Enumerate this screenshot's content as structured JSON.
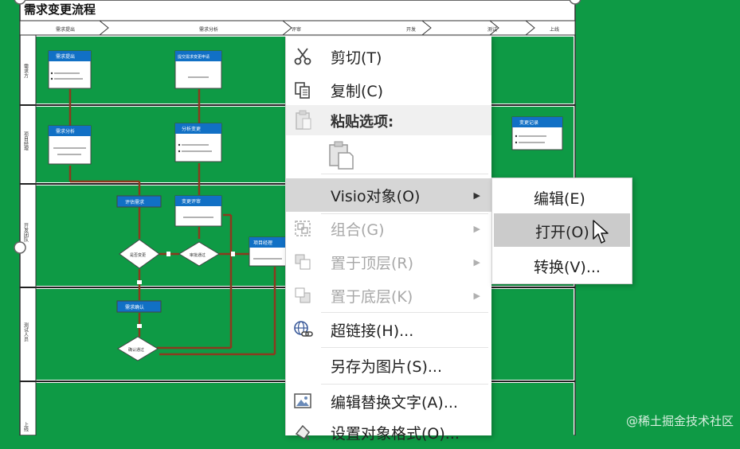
{
  "document": {
    "title": "需求变更流程",
    "lanes": [
      "需求方",
      "项目经理",
      "开发团队",
      "测试人员",
      "上线"
    ],
    "phase_columns": [
      "需求提出",
      "需求分析",
      "评审",
      "开发",
      "测试",
      "上线"
    ],
    "nodes": {
      "n1": "需求提出",
      "n2": "提交需求变更申请",
      "n3": "需求分析",
      "n4": "分析变更",
      "n5": "评估需求",
      "n6": "变更评审",
      "n7": "项目经理",
      "n8": "需求确认",
      "n9": "变更记录",
      "n10": "评估需求"
    },
    "diamonds": {
      "d1": "是否变更",
      "d2": "审批通过",
      "d3": "确认通过"
    }
  },
  "context_menu": {
    "cut": "剪切(T)",
    "copy": "复制(C)",
    "paste_options": "粘贴选项:",
    "visio_object": "Visio对象(O)",
    "group": "组合(G)",
    "bring_to_front": "置于顶层(R)",
    "send_to_back": "置于底层(K)",
    "hyperlink": "超链接(H)...",
    "save_as_picture": "另存为图片(S)...",
    "edit_alt_text": "编辑替换文字(A)...",
    "format_object": "设置对象格式(O)..."
  },
  "submenu": {
    "edit": "编辑(E)",
    "open": "打开(O)",
    "convert": "转换(V)..."
  },
  "watermark": "@稀土掘金技术社区",
  "colors": {
    "background": "#0e9a45",
    "node_header": "#1170c5",
    "connector": "#8b3a1e",
    "menu_highlight": "#d6d6d6"
  }
}
